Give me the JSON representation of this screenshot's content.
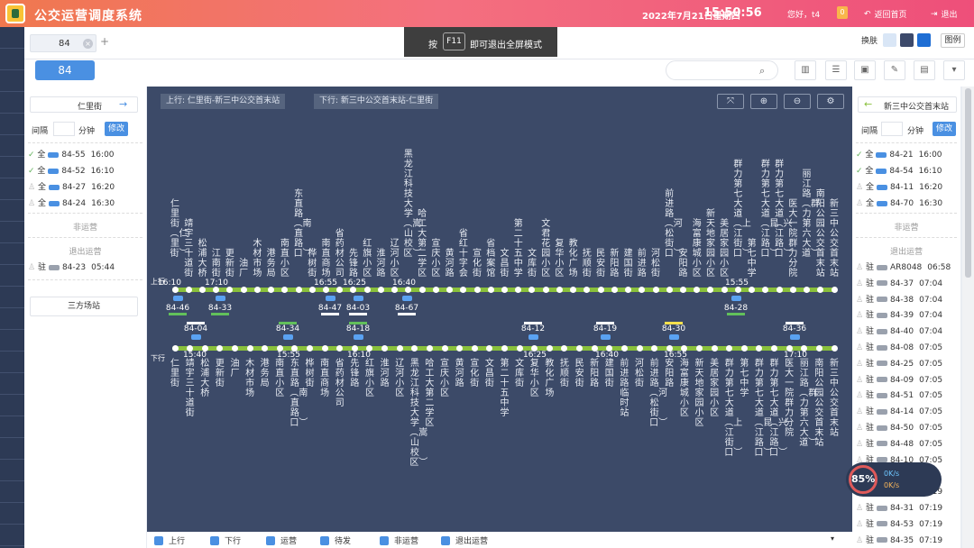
{
  "header": {
    "title": "公交运营调度系统",
    "date": "2022年7月21日星期四",
    "time": "15:50:56",
    "user": "您好，t4",
    "notify_count": "0",
    "home_label": "返回首页",
    "logout_label": "退出"
  },
  "tabs": [
    {
      "label": "84"
    }
  ],
  "toast": {
    "pre": "按",
    "key": "F11",
    "post": "即可退出全屏模式"
  },
  "toolbar": {
    "skin_label": "换肤",
    "legend_label": "图例",
    "route_button": "84",
    "skin_colors": [
      "#d9e6f6",
      "#3d4a6b",
      "#1f6ed4"
    ]
  },
  "map": {
    "up_label": "上行: 仁里街-新三中公交首末站",
    "down_label": "下行: 新三中公交首末站-仁里街",
    "up_tag": "上行",
    "down_tag": "下行",
    "up_stops": [
      "仁里街(仁里街)",
      "靖宇三十道街",
      "松浦大桥",
      "江南街",
      "更新街",
      "油厂",
      "木材市场",
      "港务局",
      "南直小区",
      "东直路(南直路口)",
      "桦树街",
      "南直商场",
      "省药材公司",
      "先锋路",
      "红旗小区",
      "淮河路",
      "辽河小区",
      "黑龙江科技大学(嵩山校区)",
      "哈工大第二学区",
      "宣庆小区",
      "黄河路",
      "省红十字会",
      "宣化街",
      "省档案馆",
      "文昌街",
      "第二十五中学",
      "文库街",
      "文君花园小区",
      "复华小区",
      "教化广场",
      "抚顺街",
      "民安街",
      "新阳路",
      "建国街",
      "前进路",
      "河松街",
      "前进路(河松街口)",
      "安阳路",
      "海富康城小区",
      "新天地家园小区",
      "美居家园小区",
      "群力第七大道(上江街口)",
      "第七中学",
      "群力第七大道(昆江路口)",
      "群力第七大道(兴江路口)",
      "医大一院群力分院",
      "丽江路(群力第六大道)",
      "南阳公园公交首末站",
      "新三中公交首末站"
    ],
    "up_times": [
      "16:10",
      "17:10",
      "16:55",
      "16:25",
      "16:40",
      "15:55"
    ],
    "up_vehicles": [
      "84-46",
      "84-33",
      "84-47",
      "84-03",
      "84-67",
      "84-28"
    ],
    "down_stops": [
      "仁里街",
      "靖宇三十道街",
      "松浦大桥",
      "更新街",
      "油厂",
      "木材市场",
      "港务局",
      "南直小区",
      "东直路(南直路口)",
      "桦树街",
      "南直商场",
      "省药材公司",
      "先锋路",
      "红旗小区",
      "淮河路",
      "辽河小区",
      "黑龙江科技大学(嵩山校区)",
      "哈工大第二学区",
      "宣庆小区",
      "黄河路",
      "宣化街",
      "文昌街",
      "第二十五中学",
      "文库街",
      "复华小区",
      "教化广场",
      "抚顺街",
      "民安街",
      "新阳路",
      "建国街",
      "前进路临时站",
      "河松街",
      "前进路(河松街口)",
      "安阳路",
      "海富康城小区",
      "新天地家园小区",
      "美居家园小区",
      "群力第七大道(上江街口)",
      "第七中学",
      "群力第七大道(昆江路口)",
      "群力第七大道(兴江路口)",
      "医大一院群力分院",
      "丽江路(群力第六大道)",
      "南阳公园公交首末站",
      "新三中公交首末站"
    ],
    "down_times": [
      "15:40",
      "15:55",
      "16:10",
      "16:25",
      "16:40",
      "16:55",
      "17:10"
    ],
    "down_vehicles": [
      "84-04",
      "84-34",
      "84-18",
      "84-12",
      "84-19",
      "84-30",
      "84-36"
    ],
    "colors": {
      "line": "#89c03b",
      "bg": "#3c4a68"
    }
  },
  "left_panel": {
    "terminal": "仁里街",
    "interval_label": "间隔",
    "minute_label": "分钟",
    "modify_label": "修改",
    "scheduled": [
      {
        "tag": "全",
        "vehicle": "84-55",
        "time": "16:00"
      },
      {
        "tag": "全",
        "vehicle": "84-52",
        "time": "16:10"
      },
      {
        "tag": "全",
        "vehicle": "84-27",
        "time": "16:20"
      },
      {
        "tag": "全",
        "vehicle": "84-24",
        "time": "16:30"
      }
    ],
    "non_operating": "非运营",
    "exit_operating": "退出运营",
    "exited": [
      {
        "tag": "驻",
        "vehicle": "84-23",
        "time": "05:44"
      }
    ],
    "depot": "三方场站"
  },
  "right_panel": {
    "terminal": "新三中公交首末站",
    "interval_label": "间隔",
    "minute_label": "分钟",
    "modify_label": "修改",
    "scheduled": [
      {
        "tag": "全",
        "vehicle": "84-21",
        "time": "16:00"
      },
      {
        "tag": "全",
        "vehicle": "84-54",
        "time": "16:10"
      },
      {
        "tag": "全",
        "vehicle": "84-11",
        "time": "16:20"
      },
      {
        "tag": "全",
        "vehicle": "84-70",
        "time": "16:30"
      }
    ],
    "non_operating": "非运营",
    "exit_operating": "退出运营",
    "exited": [
      {
        "tag": "驻",
        "vehicle": "AR8048",
        "time": "06:58"
      },
      {
        "tag": "驻",
        "vehicle": "84-37",
        "time": "07:04"
      },
      {
        "tag": "驻",
        "vehicle": "84-38",
        "time": "07:04"
      },
      {
        "tag": "驻",
        "vehicle": "84-39",
        "time": "07:04"
      },
      {
        "tag": "驻",
        "vehicle": "84-40",
        "time": "07:04"
      },
      {
        "tag": "驻",
        "vehicle": "84-08",
        "time": "07:05"
      },
      {
        "tag": "驻",
        "vehicle": "84-25",
        "time": "07:05"
      },
      {
        "tag": "驻",
        "vehicle": "84-09",
        "time": "07:05"
      },
      {
        "tag": "驻",
        "vehicle": "84-51",
        "time": "07:05"
      },
      {
        "tag": "驻",
        "vehicle": "84-14",
        "time": "07:05"
      },
      {
        "tag": "驻",
        "vehicle": "84-50",
        "time": "07:05"
      },
      {
        "tag": "驻",
        "vehicle": "84-48",
        "time": "07:05"
      },
      {
        "tag": "驻",
        "vehicle": "84-10",
        "time": "07:05"
      },
      {
        "tag": "驻",
        "vehicle": "84-...",
        "time": "07:18"
      },
      {
        "tag": "驻",
        "vehicle": "84-31",
        "time": "07:19"
      },
      {
        "tag": "驻",
        "vehicle": "84-31",
        "time": "07:19"
      },
      {
        "tag": "驻",
        "vehicle": "84-53",
        "time": "07:19"
      },
      {
        "tag": "驻",
        "vehicle": "84-35",
        "time": "07:19"
      }
    ]
  },
  "filters": [
    "上行",
    "下行",
    "运营",
    "待发",
    "非运营",
    "退出运营"
  ],
  "gauge": {
    "percent": "85%",
    "up": "0K/s",
    "down": "0K/s"
  }
}
